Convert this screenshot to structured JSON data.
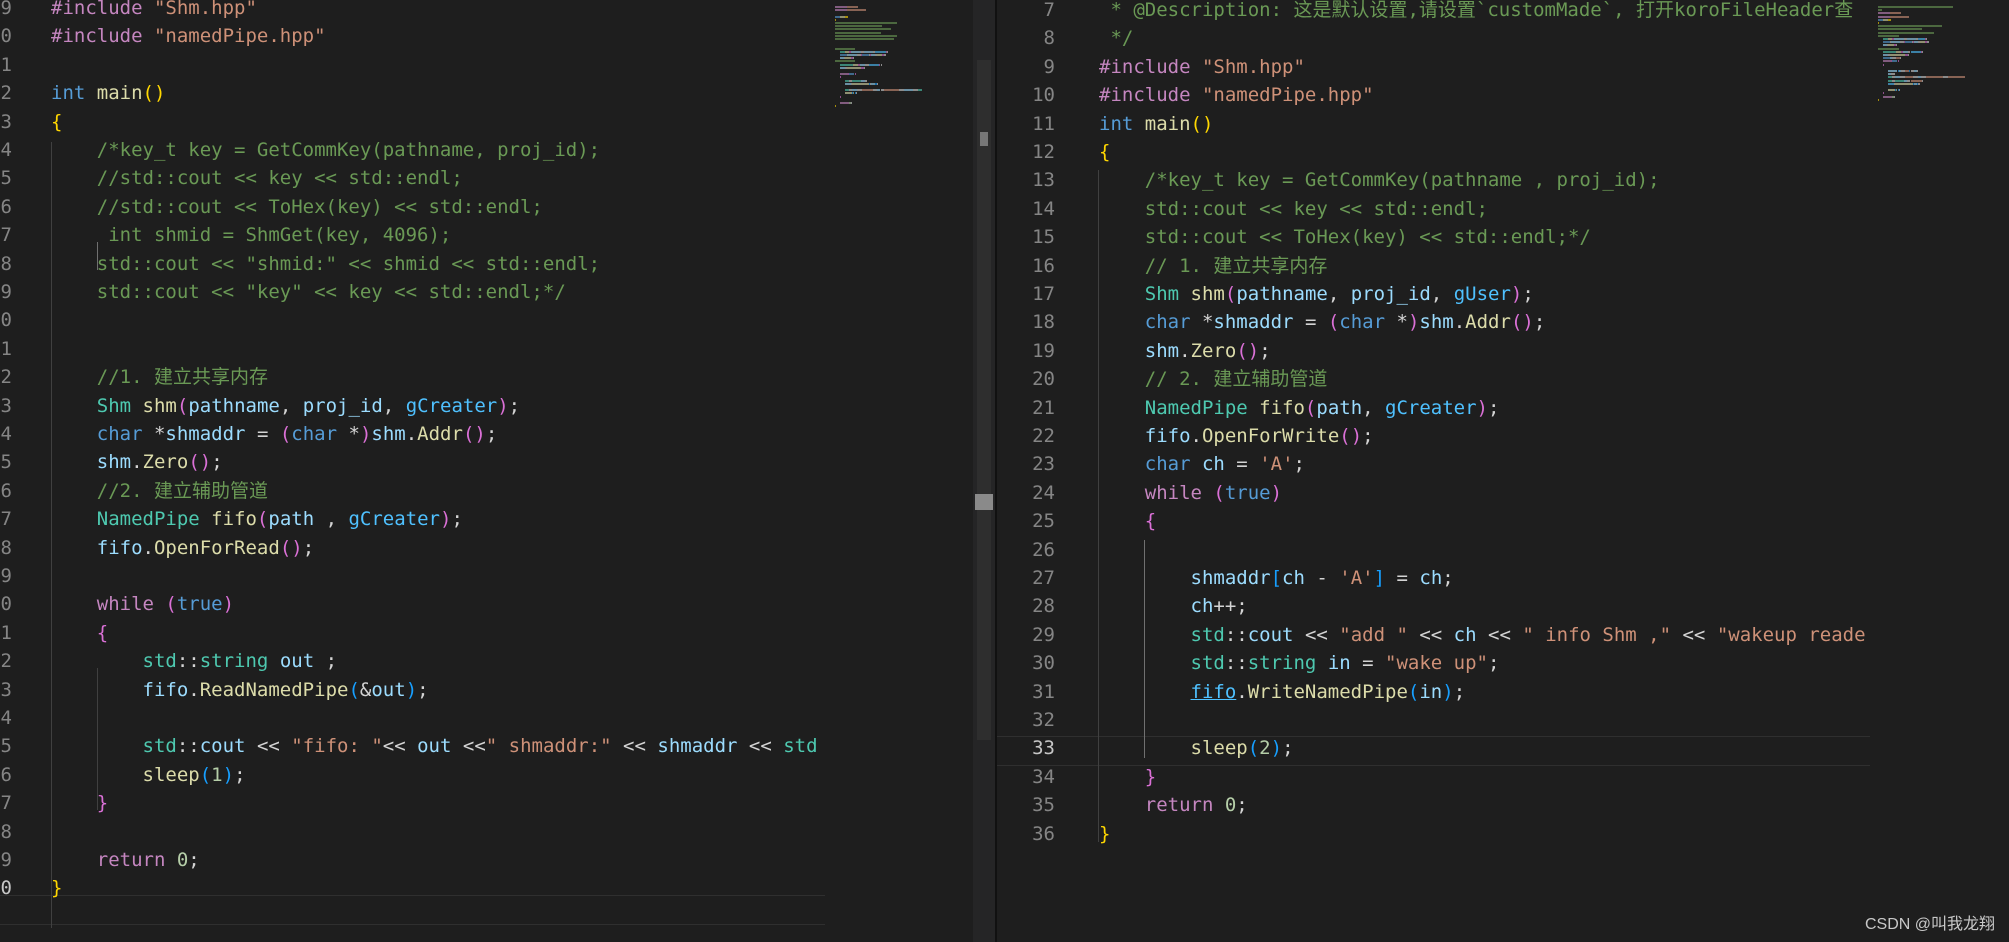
{
  "left_editor": {
    "lines": [
      {
        "n": "9",
        "tokens": [
          [
            "t-pre",
            "#include "
          ],
          [
            "t-str",
            "\"Shm.hpp\""
          ]
        ]
      },
      {
        "n": "0",
        "tokens": [
          [
            "t-pre",
            "#include "
          ],
          [
            "t-str",
            "\"namedPipe.hpp\""
          ]
        ]
      },
      {
        "n": "1",
        "tokens": []
      },
      {
        "n": "2",
        "tokens": [
          [
            "t-kw",
            "int "
          ],
          [
            "t-fn",
            "main"
          ],
          [
            "t-p1",
            "()"
          ]
        ]
      },
      {
        "n": "3",
        "tokens": [
          [
            "t-p1",
            "{"
          ]
        ]
      },
      {
        "n": "4",
        "tokens": [
          [
            "t-com",
            "    /*key_t key = GetCommKey(pathname, proj_id);"
          ]
        ]
      },
      {
        "n": "5",
        "tokens": [
          [
            "t-com",
            "    //std::cout << key << std::endl;"
          ]
        ]
      },
      {
        "n": "6",
        "tokens": [
          [
            "t-com",
            "    //std::cout << ToHex(key) << std::endl;"
          ]
        ]
      },
      {
        "n": "7",
        "tokens": [
          [
            "t-com",
            "     int shmid = ShmGet(key, 4096);"
          ]
        ]
      },
      {
        "n": "8",
        "tokens": [
          [
            "t-com",
            "    std::cout << \"shmid:\" << shmid << std::endl;"
          ]
        ]
      },
      {
        "n": "9",
        "tokens": [
          [
            "t-com",
            "    std::cout << \"key\" << key << std::endl;*/"
          ]
        ]
      },
      {
        "n": "0",
        "tokens": []
      },
      {
        "n": "1",
        "tokens": []
      },
      {
        "n": "2",
        "tokens": [
          [
            "t-com",
            "    //1. 建立共享内存"
          ]
        ]
      },
      {
        "n": "3",
        "tokens": [
          [
            "t-txt",
            "    "
          ],
          [
            "t-type",
            "Shm "
          ],
          [
            "t-fn",
            "shm"
          ],
          [
            "t-p2",
            "("
          ],
          [
            "t-var",
            "pathname"
          ],
          [
            "t-txt",
            ", "
          ],
          [
            "t-var",
            "proj_id"
          ],
          [
            "t-txt",
            ", "
          ],
          [
            "t-const",
            "gCreater"
          ],
          [
            "t-p2",
            ")"
          ],
          [
            "t-txt",
            ";"
          ]
        ]
      },
      {
        "n": "4",
        "tokens": [
          [
            "t-txt",
            "    "
          ],
          [
            "t-kw",
            "char "
          ],
          [
            "t-txt",
            "*"
          ],
          [
            "t-var",
            "shmaddr"
          ],
          [
            "t-txt",
            " = "
          ],
          [
            "t-p2",
            "("
          ],
          [
            "t-kw",
            "char "
          ],
          [
            "t-txt",
            "*"
          ],
          [
            "t-p2",
            ")"
          ],
          [
            "t-var",
            "shm"
          ],
          [
            "t-txt",
            "."
          ],
          [
            "t-fn",
            "Addr"
          ],
          [
            "t-p2",
            "()"
          ],
          [
            "t-txt",
            ";"
          ]
        ]
      },
      {
        "n": "5",
        "tokens": [
          [
            "t-txt",
            "    "
          ],
          [
            "t-var",
            "shm"
          ],
          [
            "t-txt",
            "."
          ],
          [
            "t-fn",
            "Zero"
          ],
          [
            "t-p2",
            "()"
          ],
          [
            "t-txt",
            ";"
          ]
        ]
      },
      {
        "n": "6",
        "tokens": [
          [
            "t-com",
            "    //2. 建立辅助管道"
          ]
        ]
      },
      {
        "n": "7",
        "tokens": [
          [
            "t-txt",
            "    "
          ],
          [
            "t-type",
            "NamedPipe "
          ],
          [
            "t-fn",
            "fifo"
          ],
          [
            "t-p2",
            "("
          ],
          [
            "t-var",
            "path"
          ],
          [
            "t-txt",
            " , "
          ],
          [
            "t-const",
            "gCreater"
          ],
          [
            "t-p2",
            ")"
          ],
          [
            "t-txt",
            ";"
          ]
        ]
      },
      {
        "n": "8",
        "tokens": [
          [
            "t-txt",
            "    "
          ],
          [
            "t-var",
            "fifo"
          ],
          [
            "t-txt",
            "."
          ],
          [
            "t-fn",
            "OpenForRead"
          ],
          [
            "t-p2",
            "()"
          ],
          [
            "t-txt",
            ";"
          ]
        ]
      },
      {
        "n": "9",
        "tokens": []
      },
      {
        "n": "0",
        "tokens": [
          [
            "t-txt",
            "    "
          ],
          [
            "t-ctl",
            "while "
          ],
          [
            "t-p2",
            "("
          ],
          [
            "t-kw",
            "true"
          ],
          [
            "t-p2",
            ")"
          ]
        ]
      },
      {
        "n": "1",
        "tokens": [
          [
            "t-txt",
            "    "
          ],
          [
            "t-p2",
            "{"
          ]
        ]
      },
      {
        "n": "2",
        "tokens": [
          [
            "t-txt",
            "        "
          ],
          [
            "t-type",
            "std"
          ],
          [
            "t-txt",
            "::"
          ],
          [
            "t-type",
            "string "
          ],
          [
            "t-var",
            "out"
          ],
          [
            "t-txt",
            " ;"
          ]
        ]
      },
      {
        "n": "3",
        "tokens": [
          [
            "t-txt",
            "        "
          ],
          [
            "t-var",
            "fifo"
          ],
          [
            "t-txt",
            "."
          ],
          [
            "t-fn",
            "ReadNamedPipe"
          ],
          [
            "t-p3",
            "("
          ],
          [
            "t-txt",
            "&"
          ],
          [
            "t-var",
            "out"
          ],
          [
            "t-p3",
            ")"
          ],
          [
            "t-txt",
            ";"
          ]
        ]
      },
      {
        "n": "4",
        "tokens": []
      },
      {
        "n": "5",
        "tokens": [
          [
            "t-txt",
            "        "
          ],
          [
            "t-type",
            "std"
          ],
          [
            "t-txt",
            "::"
          ],
          [
            "t-var",
            "cout"
          ],
          [
            "t-txt",
            " << "
          ],
          [
            "t-str",
            "\"fifo: \""
          ],
          [
            "t-txt",
            "<< "
          ],
          [
            "t-var",
            "out"
          ],
          [
            "t-txt",
            " <<"
          ],
          [
            "t-str",
            "\" shmaddr:\""
          ],
          [
            "t-txt",
            " << "
          ],
          [
            "t-var",
            "shmaddr"
          ],
          [
            "t-txt",
            " << "
          ],
          [
            "t-type",
            "std"
          ]
        ]
      },
      {
        "n": "6",
        "tokens": [
          [
            "t-txt",
            "        "
          ],
          [
            "t-fn",
            "sleep"
          ],
          [
            "t-p3",
            "("
          ],
          [
            "t-num",
            "1"
          ],
          [
            "t-p3",
            ")"
          ],
          [
            "t-txt",
            ";"
          ]
        ]
      },
      {
        "n": "7",
        "tokens": [
          [
            "t-txt",
            "    "
          ],
          [
            "t-p2",
            "}"
          ]
        ]
      },
      {
        "n": "8",
        "tokens": []
      },
      {
        "n": "9",
        "tokens": [
          [
            "t-txt",
            "    "
          ],
          [
            "t-ctl",
            "return "
          ],
          [
            "t-num",
            "0"
          ],
          [
            "t-txt",
            ";"
          ]
        ]
      },
      {
        "n": "0",
        "tokens": [
          [
            "t-p1",
            "}"
          ]
        ]
      }
    ]
  },
  "right_editor": {
    "lines": [
      {
        "n": "7",
        "tokens": [
          [
            "t-com",
            " * @Description: 这是默认设置,请设置`customMade`, 打开koroFileHeader查"
          ]
        ]
      },
      {
        "n": "8",
        "tokens": [
          [
            "t-com",
            " */"
          ]
        ]
      },
      {
        "n": "9",
        "tokens": [
          [
            "t-pre",
            "#include "
          ],
          [
            "t-str",
            "\"Shm.hpp\""
          ]
        ]
      },
      {
        "n": "10",
        "tokens": [
          [
            "t-pre",
            "#include "
          ],
          [
            "t-str",
            "\"namedPipe.hpp\""
          ]
        ]
      },
      {
        "n": "11",
        "tokens": [
          [
            "t-kw",
            "int "
          ],
          [
            "t-fn",
            "main"
          ],
          [
            "t-p1",
            "()"
          ]
        ]
      },
      {
        "n": "12",
        "tokens": [
          [
            "t-p1",
            "{"
          ]
        ]
      },
      {
        "n": "13",
        "tokens": [
          [
            "t-com",
            "    /*key_t key = GetCommKey(pathname , proj_id);"
          ]
        ]
      },
      {
        "n": "14",
        "tokens": [
          [
            "t-com",
            "    std::cout << key << std::endl;"
          ]
        ]
      },
      {
        "n": "15",
        "tokens": [
          [
            "t-com",
            "    std::cout << ToHex(key) << std::endl;*/"
          ]
        ]
      },
      {
        "n": "16",
        "tokens": [
          [
            "t-com",
            "    // 1. 建立共享内存"
          ]
        ]
      },
      {
        "n": "17",
        "tokens": [
          [
            "t-txt",
            "    "
          ],
          [
            "t-type",
            "Shm "
          ],
          [
            "t-fn",
            "shm"
          ],
          [
            "t-p2",
            "("
          ],
          [
            "t-var",
            "pathname"
          ],
          [
            "t-txt",
            ", "
          ],
          [
            "t-var",
            "proj_id"
          ],
          [
            "t-txt",
            ", "
          ],
          [
            "t-const",
            "gUser"
          ],
          [
            "t-p2",
            ")"
          ],
          [
            "t-txt",
            ";"
          ]
        ]
      },
      {
        "n": "18",
        "tokens": [
          [
            "t-txt",
            "    "
          ],
          [
            "t-kw",
            "char "
          ],
          [
            "t-txt",
            "*"
          ],
          [
            "t-var",
            "shmaddr"
          ],
          [
            "t-txt",
            " = "
          ],
          [
            "t-p2",
            "("
          ],
          [
            "t-kw",
            "char "
          ],
          [
            "t-txt",
            "*"
          ],
          [
            "t-p2",
            ")"
          ],
          [
            "t-var",
            "shm"
          ],
          [
            "t-txt",
            "."
          ],
          [
            "t-fn",
            "Addr"
          ],
          [
            "t-p2",
            "()"
          ],
          [
            "t-txt",
            ";"
          ]
        ]
      },
      {
        "n": "19",
        "tokens": [
          [
            "t-txt",
            "    "
          ],
          [
            "t-var",
            "shm"
          ],
          [
            "t-txt",
            "."
          ],
          [
            "t-fn",
            "Zero"
          ],
          [
            "t-p2",
            "()"
          ],
          [
            "t-txt",
            ";"
          ]
        ]
      },
      {
        "n": "20",
        "tokens": [
          [
            "t-com",
            "    // 2. 建立辅助管道"
          ]
        ]
      },
      {
        "n": "21",
        "tokens": [
          [
            "t-txt",
            "    "
          ],
          [
            "t-type",
            "NamedPipe "
          ],
          [
            "t-fn",
            "fifo"
          ],
          [
            "t-p2",
            "("
          ],
          [
            "t-var",
            "path"
          ],
          [
            "t-txt",
            ", "
          ],
          [
            "t-const",
            "gCreater"
          ],
          [
            "t-p2",
            ")"
          ],
          [
            "t-txt",
            ";"
          ]
        ]
      },
      {
        "n": "22",
        "tokens": [
          [
            "t-txt",
            "    "
          ],
          [
            "t-var",
            "fifo"
          ],
          [
            "t-txt",
            "."
          ],
          [
            "t-fn",
            "OpenForWrite"
          ],
          [
            "t-p2",
            "()"
          ],
          [
            "t-txt",
            ";"
          ]
        ]
      },
      {
        "n": "23",
        "tokens": [
          [
            "t-txt",
            "    "
          ],
          [
            "t-kw",
            "char "
          ],
          [
            "t-var",
            "ch"
          ],
          [
            "t-txt",
            " = "
          ],
          [
            "t-str",
            "'A'"
          ],
          [
            "t-txt",
            ";"
          ]
        ]
      },
      {
        "n": "24",
        "tokens": [
          [
            "t-txt",
            "    "
          ],
          [
            "t-ctl",
            "while "
          ],
          [
            "t-p2",
            "("
          ],
          [
            "t-kw",
            "true"
          ],
          [
            "t-p2",
            ")"
          ]
        ]
      },
      {
        "n": "25",
        "tokens": [
          [
            "t-txt",
            "    "
          ],
          [
            "t-p2",
            "{"
          ]
        ]
      },
      {
        "n": "26",
        "tokens": []
      },
      {
        "n": "27",
        "tokens": [
          [
            "t-txt",
            "        "
          ],
          [
            "t-var",
            "shmaddr"
          ],
          [
            "t-p3",
            "["
          ],
          [
            "t-var",
            "ch"
          ],
          [
            "t-txt",
            " - "
          ],
          [
            "t-str",
            "'A'"
          ],
          [
            "t-p3",
            "]"
          ],
          [
            "t-txt",
            " = "
          ],
          [
            "t-var",
            "ch"
          ],
          [
            "t-txt",
            ";"
          ]
        ]
      },
      {
        "n": "28",
        "tokens": [
          [
            "t-txt",
            "        "
          ],
          [
            "t-var",
            "ch"
          ],
          [
            "t-txt",
            "++;"
          ]
        ]
      },
      {
        "n": "29",
        "tokens": [
          [
            "t-txt",
            "        "
          ],
          [
            "t-type",
            "std"
          ],
          [
            "t-txt",
            "::"
          ],
          [
            "t-var",
            "cout"
          ],
          [
            "t-txt",
            " << "
          ],
          [
            "t-str",
            "\"add \""
          ],
          [
            "t-txt",
            " << "
          ],
          [
            "t-var",
            "ch"
          ],
          [
            "t-txt",
            " << "
          ],
          [
            "t-str",
            "\" info Shm ,\""
          ],
          [
            "t-txt",
            " << "
          ],
          [
            "t-str",
            "\"wakeup reade"
          ]
        ]
      },
      {
        "n": "30",
        "tokens": [
          [
            "t-txt",
            "        "
          ],
          [
            "t-type",
            "std"
          ],
          [
            "t-txt",
            "::"
          ],
          [
            "t-type",
            "string "
          ],
          [
            "t-var",
            "in"
          ],
          [
            "t-txt",
            " = "
          ],
          [
            "t-str",
            "\"wake up\""
          ],
          [
            "t-txt",
            ";"
          ]
        ]
      },
      {
        "n": "31",
        "tokens": [
          [
            "t-txt",
            "        "
          ],
          [
            "t-link",
            "fifo"
          ],
          [
            "t-txt",
            "."
          ],
          [
            "t-fn",
            "WriteNamedPipe"
          ],
          [
            "t-p3",
            "("
          ],
          [
            "t-var",
            "in"
          ],
          [
            "t-p3",
            ")"
          ],
          [
            "t-txt",
            ";"
          ]
        ]
      },
      {
        "n": "32",
        "tokens": []
      },
      {
        "n": "33",
        "tokens": [
          [
            "t-txt",
            "        "
          ],
          [
            "t-fn",
            "sleep"
          ],
          [
            "t-p3",
            "("
          ],
          [
            "t-num",
            "2"
          ],
          [
            "t-p3",
            ")"
          ],
          [
            "t-txt",
            ";"
          ]
        ]
      },
      {
        "n": "34",
        "tokens": [
          [
            "t-txt",
            "    "
          ],
          [
            "t-p2",
            "}"
          ]
        ]
      },
      {
        "n": "35",
        "tokens": [
          [
            "t-txt",
            "    "
          ],
          [
            "t-ctl",
            "return "
          ],
          [
            "t-num",
            "0"
          ],
          [
            "t-txt",
            ";"
          ]
        ]
      },
      {
        "n": "36",
        "tokens": [
          [
            "t-p1",
            "}"
          ]
        ]
      }
    ]
  },
  "watermark": "CSDN @叫我龙翔"
}
